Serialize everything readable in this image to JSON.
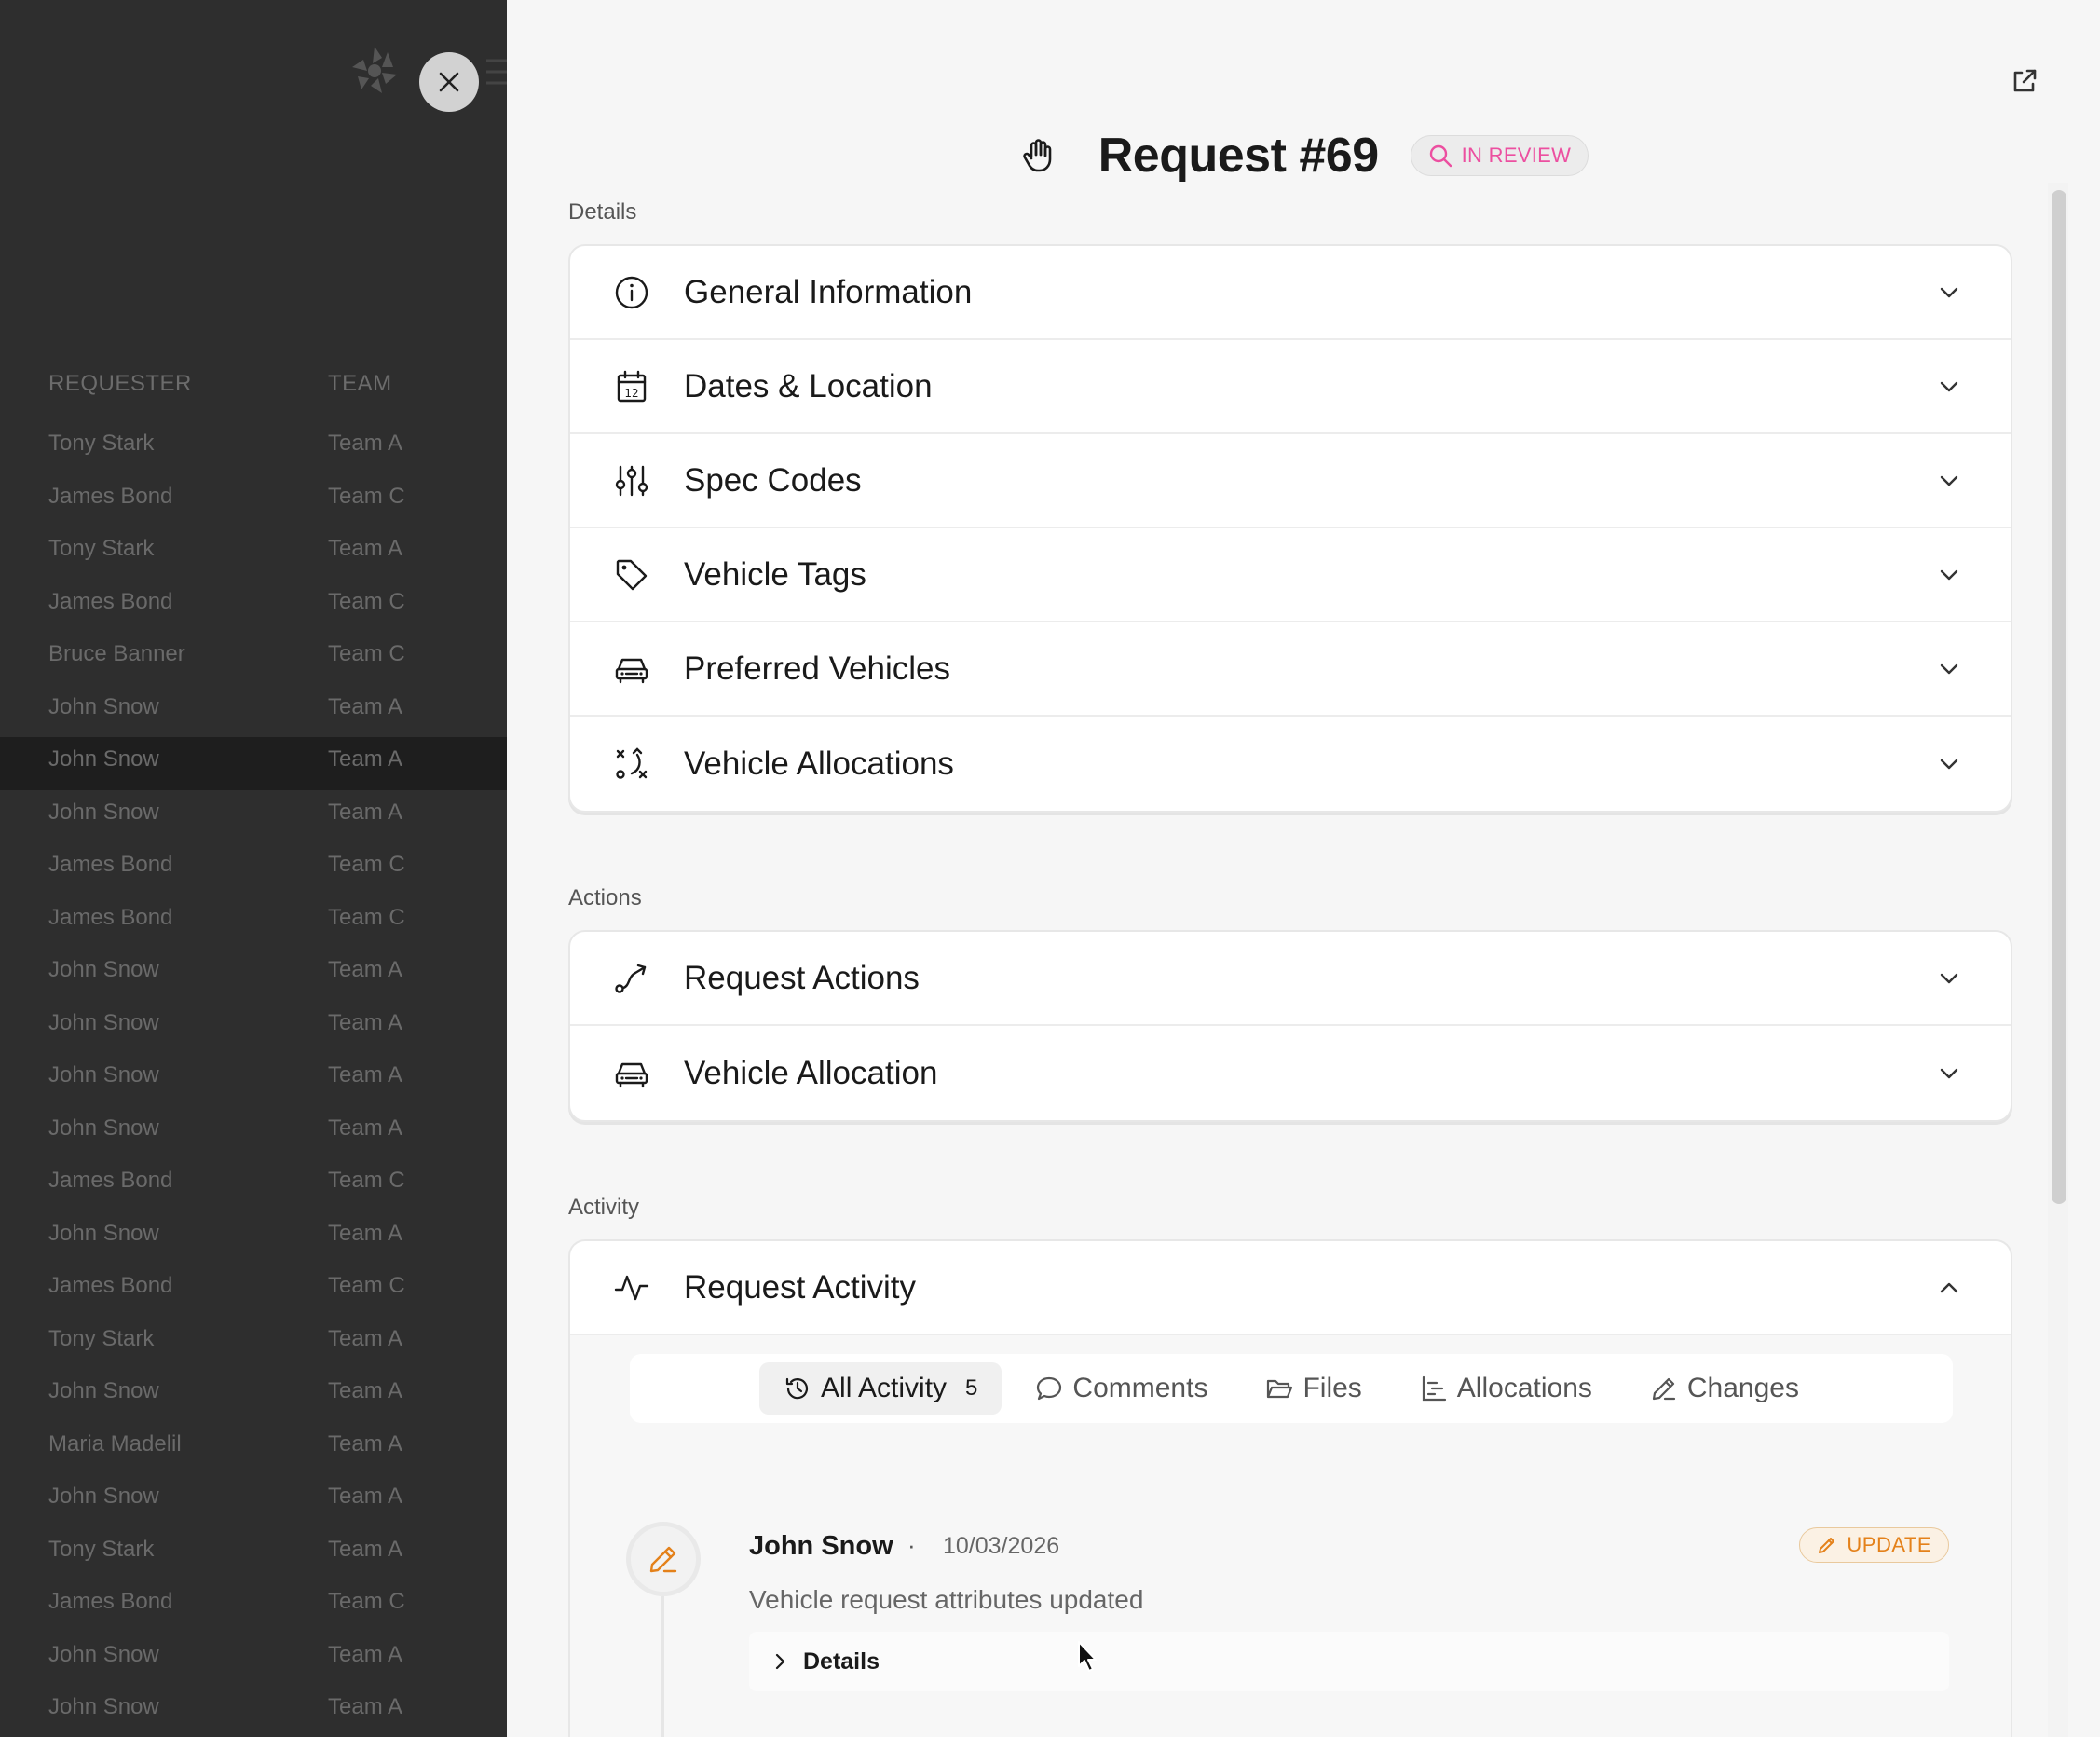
{
  "background_table": {
    "headers": {
      "requester": "REQUESTER",
      "team": "TEAM"
    },
    "rows": [
      {
        "requester": "Tony Stark",
        "team": "Team A"
      },
      {
        "requester": "James Bond",
        "team": "Team C"
      },
      {
        "requester": "Tony Stark",
        "team": "Team A"
      },
      {
        "requester": "James Bond",
        "team": "Team C"
      },
      {
        "requester": "Bruce Banner",
        "team": "Team C"
      },
      {
        "requester": "John Snow",
        "team": "Team A"
      },
      {
        "requester": "John Snow",
        "team": "Team A"
      },
      {
        "requester": "John Snow",
        "team": "Team A"
      },
      {
        "requester": "James Bond",
        "team": "Team C"
      },
      {
        "requester": "James Bond",
        "team": "Team C"
      },
      {
        "requester": "John Snow",
        "team": "Team A"
      },
      {
        "requester": "John Snow",
        "team": "Team A"
      },
      {
        "requester": "John Snow",
        "team": "Team A"
      },
      {
        "requester": "John Snow",
        "team": "Team A"
      },
      {
        "requester": "James Bond",
        "team": "Team C"
      },
      {
        "requester": "John Snow",
        "team": "Team A"
      },
      {
        "requester": "James Bond",
        "team": "Team C"
      },
      {
        "requester": "Tony Stark",
        "team": "Team A"
      },
      {
        "requester": "John Snow",
        "team": "Team A"
      },
      {
        "requester": "Maria Madelil",
        "team": "Team A"
      },
      {
        "requester": "John Snow",
        "team": "Team A"
      },
      {
        "requester": "Tony Stark",
        "team": "Team A"
      },
      {
        "requester": "James Bond",
        "team": "Team C"
      },
      {
        "requester": "John Snow",
        "team": "Team A"
      },
      {
        "requester": "John Snow",
        "team": "Team A"
      }
    ],
    "selected_index": 6
  },
  "header": {
    "title": "Request #69",
    "status": "IN REVIEW",
    "status_color": "#ec4fa0"
  },
  "sections": {
    "details_label": "Details",
    "actions_label": "Actions",
    "activity_label": "Activity"
  },
  "details": [
    {
      "label": "General Information",
      "icon": "info-icon"
    },
    {
      "label": "Dates & Location",
      "icon": "calendar-icon"
    },
    {
      "label": "Spec Codes",
      "icon": "sliders-icon"
    },
    {
      "label": "Vehicle Tags",
      "icon": "tag-icon"
    },
    {
      "label": "Preferred Vehicles",
      "icon": "car-icon"
    },
    {
      "label": "Vehicle Allocations",
      "icon": "strategy-icon"
    }
  ],
  "actions": [
    {
      "label": "Request Actions",
      "icon": "route-icon"
    },
    {
      "label": "Vehicle Allocation",
      "icon": "car-icon"
    }
  ],
  "activity": {
    "title": "Request Activity",
    "tabs": [
      {
        "label": "All Activity",
        "count": "5",
        "icon": "history-icon"
      },
      {
        "label": "Comments",
        "icon": "comment-icon"
      },
      {
        "label": "Files",
        "icon": "folder-icon"
      },
      {
        "label": "Allocations",
        "icon": "gantt-icon"
      },
      {
        "label": "Changes",
        "icon": "pencil-icon"
      }
    ],
    "entry": {
      "author": "John Snow",
      "separator": "·",
      "date": "10/03/2026",
      "badge": "UPDATE",
      "badge_color": "#e4811a",
      "text": "Vehicle request attributes updated",
      "details_label": "Details"
    }
  }
}
